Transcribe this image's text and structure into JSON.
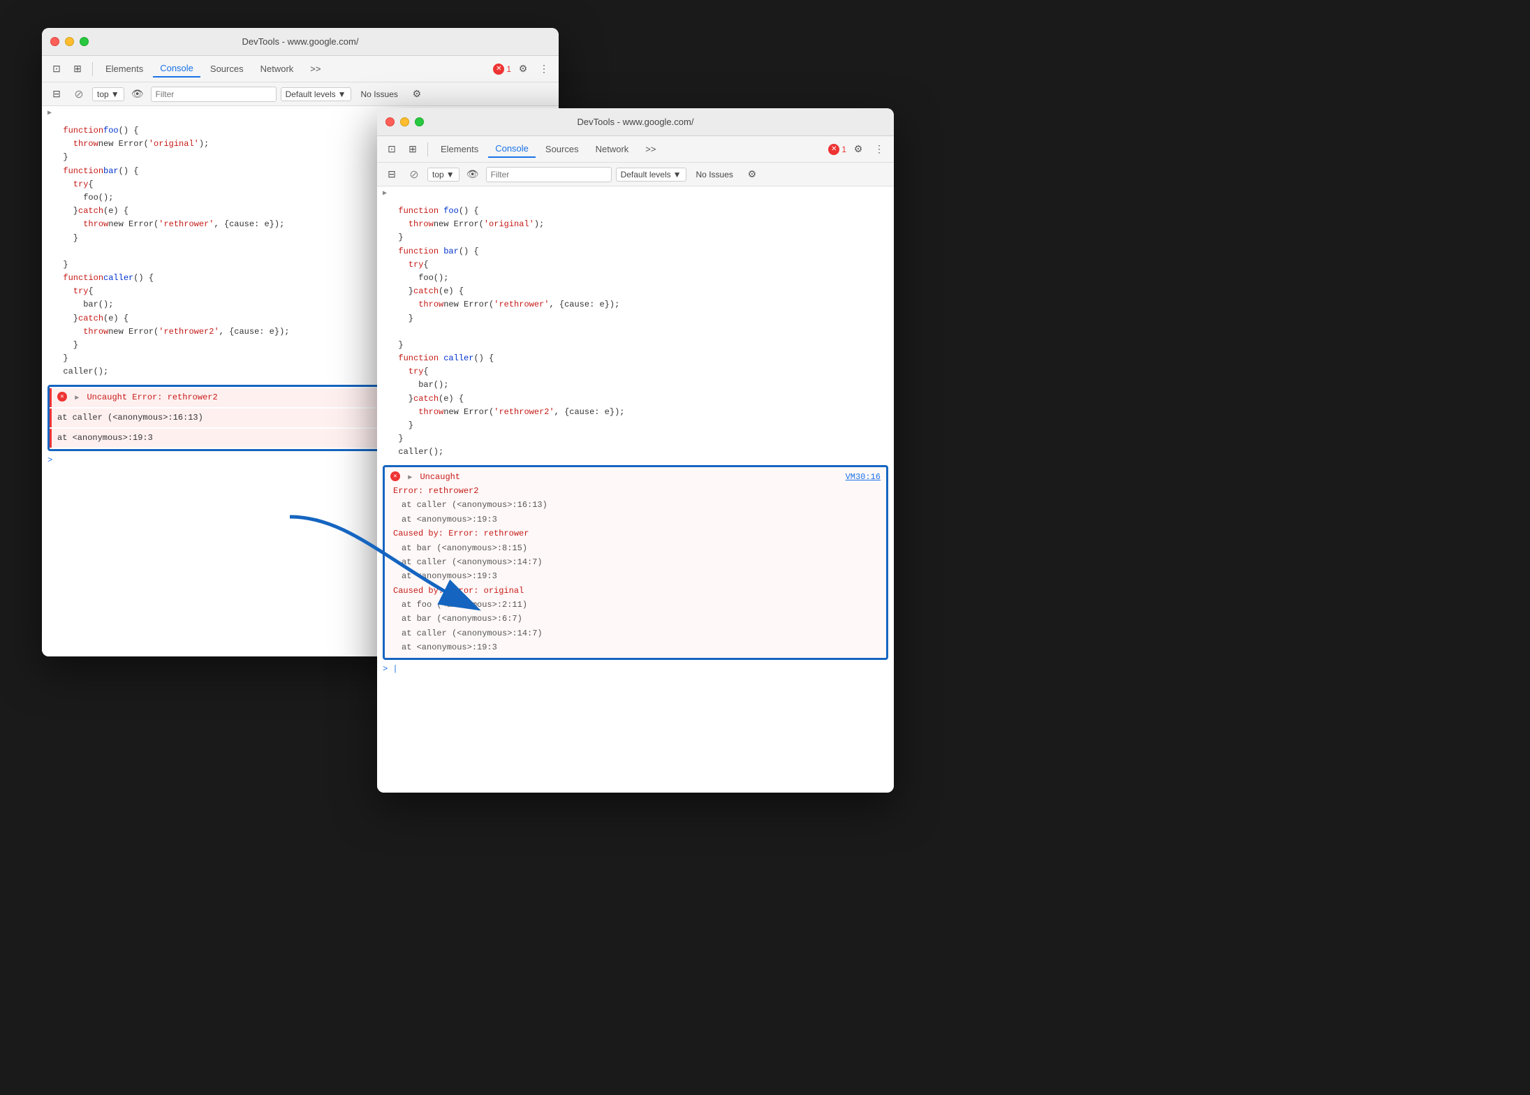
{
  "window_back": {
    "title": "DevTools - www.google.com/",
    "tabs": [
      "Elements",
      "Console",
      "Sources",
      "Network",
      ">>"
    ],
    "active_tab": "Console",
    "toolbar": {
      "top_label": "top",
      "filter_placeholder": "Filter",
      "default_levels": "Default levels",
      "no_issues": "No Issues",
      "error_count": "1"
    },
    "code": [
      ">",
      "function foo() {",
      "  throw new Error('original');",
      "}",
      "function bar() {",
      "  try {",
      "    foo();",
      "  } catch (e) {",
      "    throw new Error('rethrower', {cause: e});",
      "  }",
      "",
      "}",
      "function caller() {",
      "  try {",
      "    bar();",
      "  } catch (e) {",
      "    throw new Error('rethrower2', {cause: e});",
      "  }",
      "}",
      "caller();"
    ],
    "error": {
      "main": "Uncaught Error: rethrower2",
      "line1": "at caller (<anonymous>:16:13)",
      "line2": "at <anonymous>:19:3"
    }
  },
  "window_front": {
    "title": "DevTools - www.google.com/",
    "tabs": [
      "Elements",
      "Console",
      "Sources",
      "Network",
      ">>"
    ],
    "active_tab": "Console",
    "toolbar": {
      "top_label": "top",
      "filter_placeholder": "Filter",
      "default_levels": "Default levels",
      "no_issues": "No Issues",
      "error_count": "1"
    },
    "code": [
      ">",
      "function foo() {",
      "  throw new Error('original');",
      "}",
      "function bar() {",
      "  try {",
      "    foo();",
      "  } catch (e) {",
      "    throw new Error('rethrower', {cause: e});",
      "  }",
      "",
      "}",
      "function caller() {",
      "  try {",
      "    bar();",
      "  } catch (e) {",
      "    throw new Error('rethrower2', {cause: e});",
      "  }",
      "}",
      "caller();"
    ],
    "error_detail": {
      "header": "Uncaught",
      "vm_link": "VM30:16",
      "lines": [
        "Error: rethrower2",
        "    at caller (<anonymous>:16:13)",
        "    at <anonymous>:19:3",
        "Caused by: Error: rethrower",
        "    at bar (<anonymous>:8:15)",
        "    at caller (<anonymous>:14:7)",
        "    at <anonymous>:19:3",
        "Caused by: Error: original",
        "    at foo (<anonymous>:2:11)",
        "    at bar (<anonymous>:6:7)",
        "    at caller (<anonymous>:14:7)",
        "    at <anonymous>:19:3"
      ]
    }
  },
  "icons": {
    "inspect": "⊡",
    "device": "⊞",
    "cursor": "↖",
    "eye": "👁",
    "gear": "⚙",
    "dots": "⋮",
    "error": "✕",
    "expand": "▶",
    "circle_no": "⊘"
  }
}
